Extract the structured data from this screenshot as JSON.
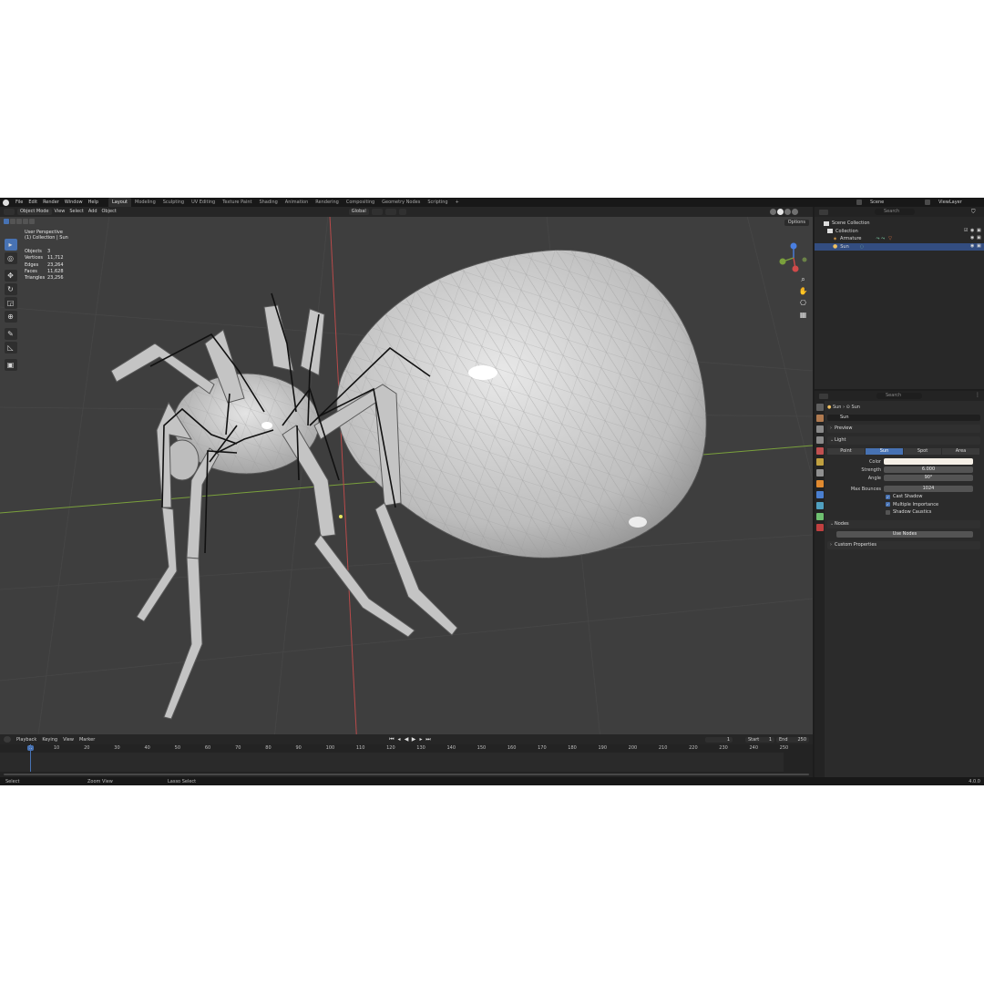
{
  "menu": {
    "items": [
      "File",
      "Edit",
      "Render",
      "Window",
      "Help"
    ],
    "workspaces": [
      "Layout",
      "Modeling",
      "Sculpting",
      "UV Editing",
      "Texture Paint",
      "Shading",
      "Animation",
      "Rendering",
      "Compositing",
      "Geometry Nodes",
      "Scripting"
    ],
    "active_workspace": "Layout",
    "add_tab": "+",
    "scene": "Scene",
    "view_layer": "ViewLayer"
  },
  "viewport": {
    "mode": "Object Mode",
    "menus": [
      "View",
      "Select",
      "Add",
      "Object"
    ],
    "transform_orientation": "Global",
    "options": "Options",
    "view_name": "User Perspective",
    "collection_info": "(1) Collection | Sun",
    "stats": [
      {
        "label": "Objects",
        "value": "3"
      },
      {
        "label": "Vertices",
        "value": "11,712"
      },
      {
        "label": "Edges",
        "value": "23,264"
      },
      {
        "label": "Faces",
        "value": "11,628"
      },
      {
        "label": "Triangles",
        "value": "23,256"
      }
    ],
    "axis_x_color": "#e05a5a",
    "axis_y_color": "#8fbf45"
  },
  "timeline": {
    "menus": [
      "Playback",
      "Keying",
      "View",
      "Marker"
    ],
    "current_frame": "1",
    "start_label": "Start",
    "start": "1",
    "end_label": "End",
    "end": "250",
    "ticks": [
      "1",
      "10",
      "20",
      "30",
      "40",
      "50",
      "60",
      "70",
      "80",
      "90",
      "100",
      "110",
      "120",
      "130",
      "140",
      "150",
      "160",
      "170",
      "180",
      "190",
      "200",
      "210",
      "220",
      "230",
      "240",
      "250"
    ]
  },
  "status": {
    "select": "Select",
    "zoom": "Zoom View",
    "lasso": "Lasso Select",
    "version": "4.0.0"
  },
  "outliner": {
    "search_placeholder": "Search",
    "rows": [
      {
        "label": "Scene Collection"
      },
      {
        "label": "Collection"
      },
      {
        "label": "Armature"
      },
      {
        "label": "Sun"
      }
    ]
  },
  "properties": {
    "search_placeholder": "Search",
    "crumb_object": "Sun",
    "crumb_data": "Sun",
    "data_name": "Sun",
    "sections": {
      "preview": "Preview",
      "light": "Light",
      "nodes": "Nodes",
      "custom": "Custom Properties"
    },
    "light_types": [
      "Point",
      "Sun",
      "Spot",
      "Area"
    ],
    "active_type": "Sun",
    "fields": [
      {
        "label": "Color",
        "value": ""
      },
      {
        "label": "Strength",
        "value": "6.000"
      },
      {
        "label": "Angle",
        "value": "90°"
      },
      {
        "label": "Max Bounces",
        "value": "1024"
      }
    ],
    "checkboxes": [
      {
        "label": "Cast Shadow",
        "checked": true
      },
      {
        "label": "Multiple Importance",
        "checked": true
      },
      {
        "label": "Shadow Caustics",
        "checked": false
      }
    ],
    "use_nodes": "Use Nodes",
    "light_color": "#f5efe6"
  }
}
